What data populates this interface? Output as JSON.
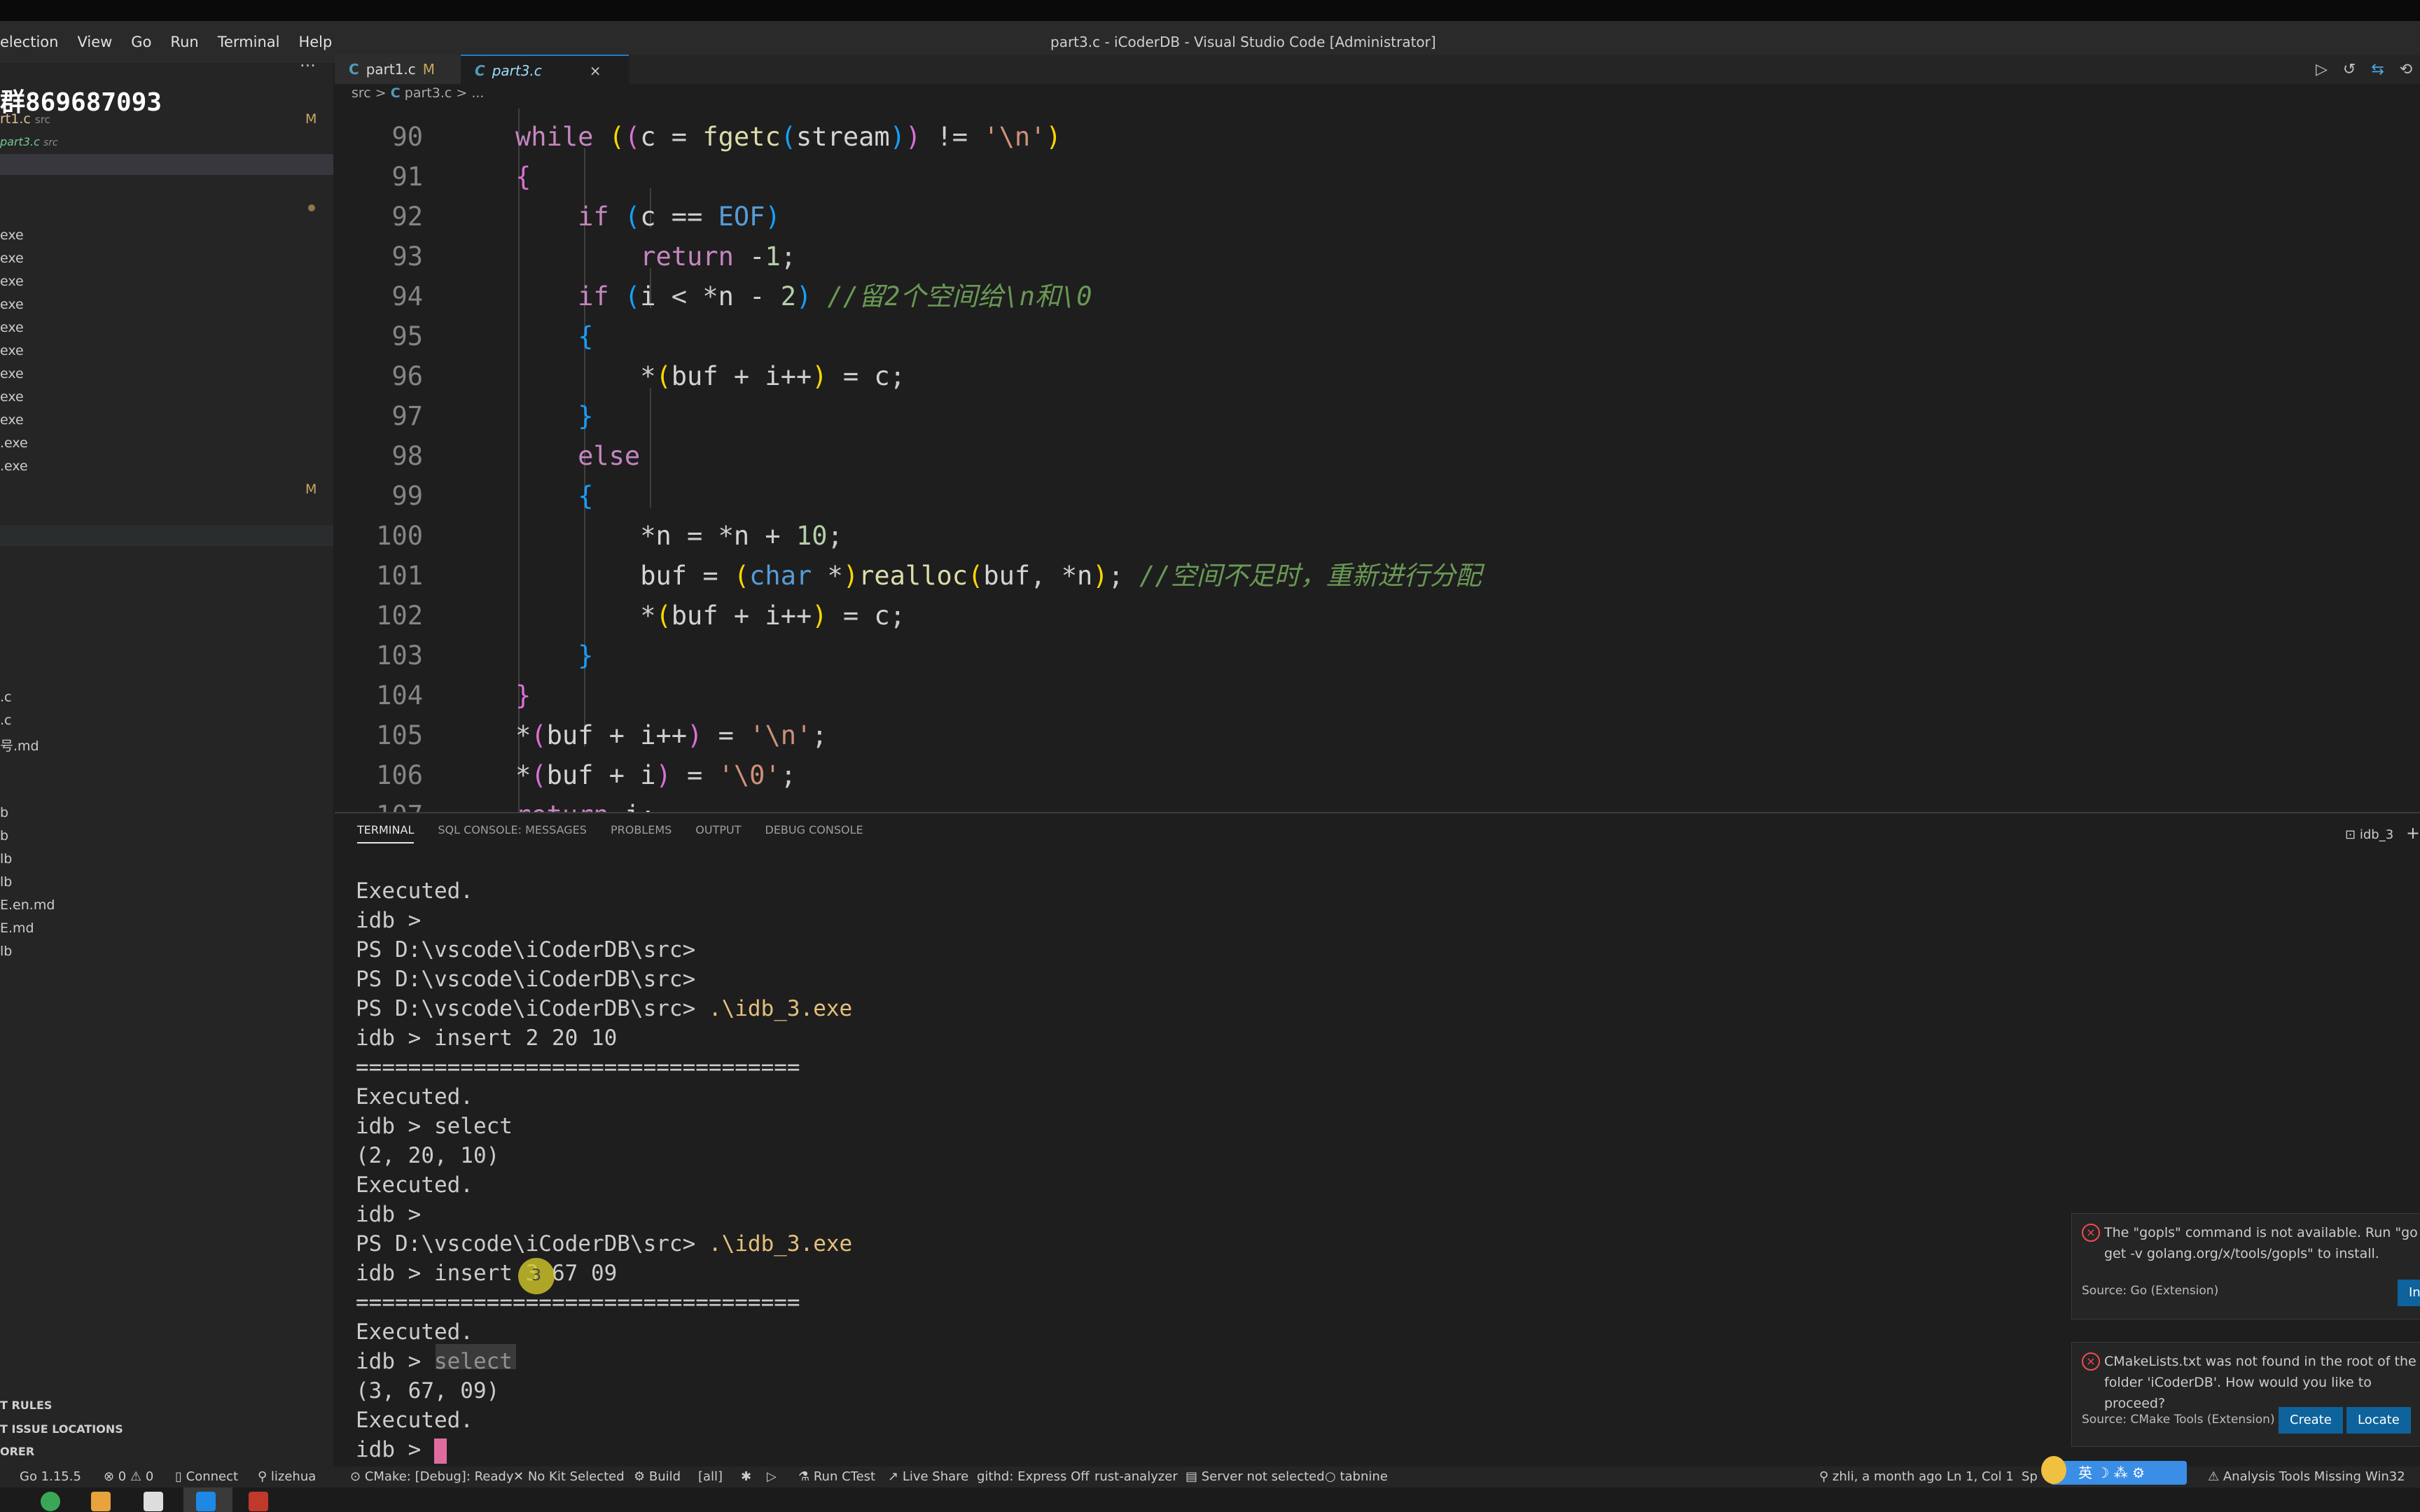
{
  "menu": [
    "election",
    "View",
    "Go",
    "Run",
    "Terminal",
    "Help"
  ],
  "window_title": "part3.c - iCoderDB - Visual Studio Code [Administrator]",
  "sidebar": {
    "more": "···",
    "qq_text": "群869687093",
    "files": [
      "rt1.c",
      "part3.c",
      "exe",
      "exe",
      "exe",
      "exe",
      "exe",
      "exe",
      "exe",
      "exe",
      "exe",
      ".exe",
      ".exe",
      ".c",
      ".c",
      "号.md",
      "b",
      "b",
      "lb",
      "lb",
      "E.en.md",
      "E.md",
      "lb"
    ],
    "file_hints": [
      "src",
      "src"
    ],
    "m_badge": "M",
    "outline": [
      "T RULES",
      "T ISSUE LOCATIONS",
      "ORER"
    ]
  },
  "tabs": [
    {
      "icon": "C",
      "label": "part1.c",
      "badge": "M"
    },
    {
      "icon": "C",
      "label": "part3.c",
      "close": "×"
    }
  ],
  "breadcrumb": [
    "src",
    ">",
    "C",
    "part3.c",
    ">",
    "..."
  ],
  "editor": {
    "line_numbers": [
      "90",
      "91",
      "92",
      "93",
      "94",
      "95",
      "96",
      "97",
      "98",
      "99",
      "100",
      "101",
      "102",
      "103",
      "104",
      "105",
      "106",
      "107"
    ],
    "comment_94": "//留2个空间给\\n和\\0",
    "comment_101": "//空间不足时，重新进行分配"
  },
  "panel": {
    "tabs": [
      "TERMINAL",
      "SQL CONSOLE: MESSAGES",
      "PROBLEMS",
      "OUTPUT",
      "DEBUG CONSOLE"
    ],
    "terminal_name": "idb_3",
    "add": "+",
    "lines": [
      "Executed.",
      "idb >",
      "PS D:\\vscode\\iCoderDB\\src>",
      "PS D:\\vscode\\iCoderDB\\src>",
      "PS D:\\vscode\\iCoderDB\\src> ",
      "idb > insert 2 20 10",
      "==================================",
      "Executed.",
      "idb > select",
      "(2, 20, 10)",
      "Executed.",
      "idb >",
      "PS D:\\vscode\\iCoderDB\\src> ",
      "idb > insert 3 67 09",
      "==================================",
      "Executed.",
      "idb > select",
      "(3, 67, 09)",
      "Executed.",
      "idb > "
    ],
    "exe_cmd": ".\\idb_3.exe",
    "click_num": "3"
  },
  "notifications": [
    {
      "message": "The \"gopls\" command is not available. Run \"go get -v golang.org/x/tools/gopls\" to install.",
      "source": "Source: Go (Extension)",
      "buttons": [
        "In"
      ]
    },
    {
      "message": "CMakeLists.txt was not found in the root of the folder 'iCoderDB'. How would you like to proceed?",
      "source": "Source: CMake Tools (Extension)",
      "buttons": [
        "Create",
        "Locate"
      ]
    }
  ],
  "status": {
    "go": "Go 1.15.5",
    "problems": "⊗ 0 ⚠ 0",
    "connect": "Connect",
    "user": "lizehua",
    "cmake": "CMake: [Debug]: Ready",
    "kit": "No Kit Selected",
    "build": "Build",
    "all": "[all]",
    "ctest": "Run CTest",
    "live": "Live Share",
    "githd": "githd: Express Off",
    "rust": "rust-analyzer",
    "server": "Server not selected",
    "tabnine": "tabnine",
    "blame": "zhli, a month ago",
    "pos": "Ln 1, Col 1",
    "spaces": "Sp",
    "analysis": "Analysis Tools Missing",
    "platform": "Win32",
    "ime": "英 ☽ ⁂ ⚙"
  },
  "colors": {
    "accent": "#0e639c",
    "error": "#f14c4c",
    "modified": "#c9a95c"
  }
}
